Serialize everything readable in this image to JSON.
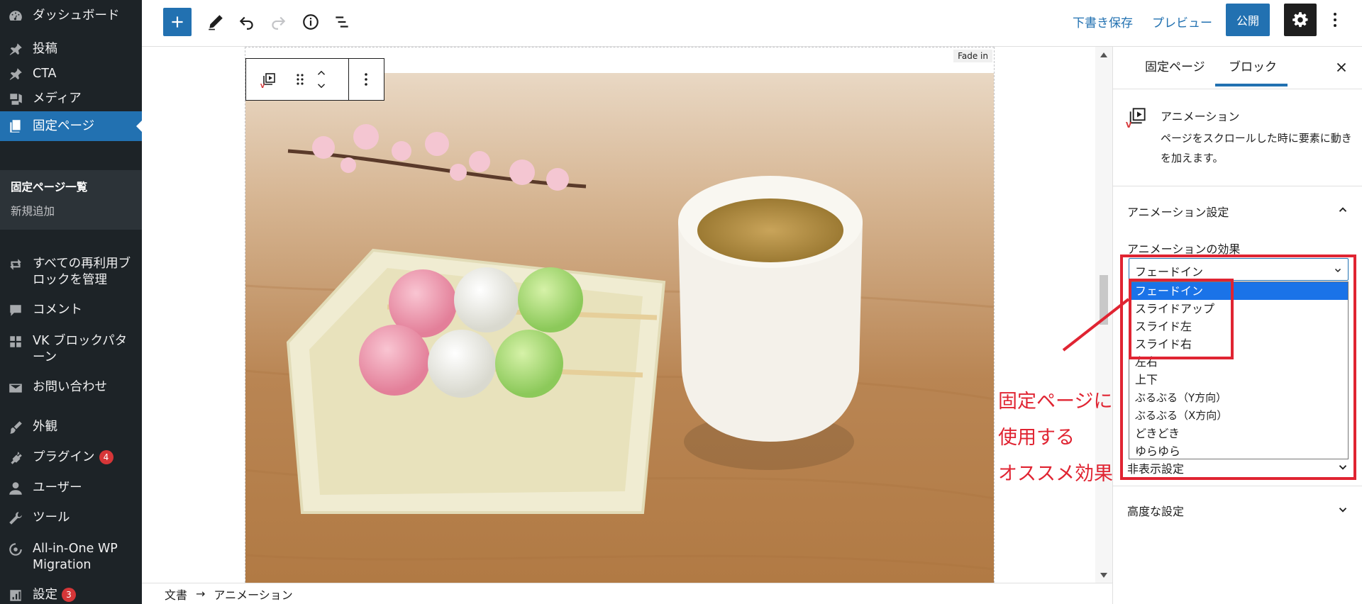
{
  "sidebar": {
    "items": [
      {
        "label": "ダッシュボード",
        "icon": "dashboard-icon"
      },
      {
        "label": "投稿",
        "icon": "pin-icon"
      },
      {
        "label": "CTA",
        "icon": "pin-icon"
      },
      {
        "label": "メディア",
        "icon": "media-icon"
      },
      {
        "label": "固定ページ",
        "icon": "pages-icon"
      },
      {
        "label": "すべての再利用ブロックを管理",
        "icon": "reusable-blocks-icon"
      },
      {
        "label": "コメント",
        "icon": "comment-icon"
      },
      {
        "label": "VK ブロックパターン",
        "icon": "grid-icon"
      },
      {
        "label": "お問い合わせ",
        "icon": "mail-icon"
      },
      {
        "label": "外観",
        "icon": "brush-icon"
      },
      {
        "label": "プラグイン",
        "icon": "plugin-icon",
        "badge": "4"
      },
      {
        "label": "ユーザー",
        "icon": "user-icon"
      },
      {
        "label": "ツール",
        "icon": "wrench-icon"
      },
      {
        "label": "All-in-One WP Migration",
        "icon": "migration-icon"
      },
      {
        "label": "設定",
        "icon": "settings-icon",
        "badge": "3"
      }
    ],
    "submenu": {
      "list_label": "固定ページ一覧",
      "add_label": "新規追加"
    }
  },
  "topbar": {
    "save_draft": "下書き保存",
    "preview": "プレビュー",
    "publish": "公開"
  },
  "canvas": {
    "fade_tag": "Fade in",
    "annotation_lines": [
      "固定ページに",
      "使用する",
      "オススメ効果"
    ]
  },
  "breadcrumb": {
    "root": "文書",
    "arrow": "→",
    "current": "アニメーション"
  },
  "panel": {
    "tabs": [
      "固定ページ",
      "ブロック"
    ],
    "block_title": "アニメーション",
    "block_description": "ページをスクロールした時に要素に動きを加えます。",
    "animation_section": "アニメーション設定",
    "effect_label": "アニメーションの効果",
    "selected_effect": "フェードイン",
    "options": [
      "フェードイン",
      "スライドアップ",
      "スライド左",
      "スライド右",
      "左右",
      "上下",
      "ぶるぶる（Y方向）",
      "ぶるぶる（X方向）",
      "どきどき",
      "ゆらゆら"
    ],
    "visibility_section": "非表示設定",
    "advanced_section": "高度な設定"
  },
  "colors": {
    "accent": "#2271b1",
    "sidebar_bg": "#1d2327",
    "highlight_red": "#e02432",
    "selected_option": "#1a73e8"
  }
}
